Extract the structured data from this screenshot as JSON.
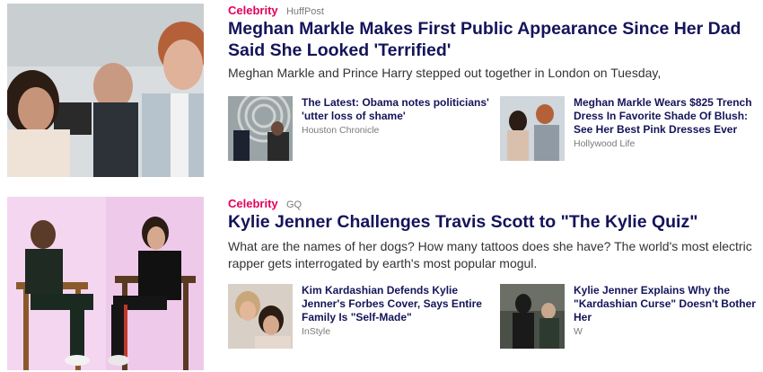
{
  "stories": [
    {
      "category": "Celebrity",
      "source": "HuffPost",
      "headline": "Meghan Markle Makes First Public Appearance Since Her Dad Said She Looked 'Terrified'",
      "summary": "Meghan Markle and Prince Harry stepped out together in London on Tuesday,",
      "related": [
        {
          "title": "The Latest: Obama notes politicians' 'utter loss of shame'",
          "source": "Houston Chronicle"
        },
        {
          "title": "Meghan Markle Wears $825 Trench Dress In Favorite Shade Of Blush: See Her Best Pink Dresses Ever",
          "source": "Hollywood Life"
        }
      ]
    },
    {
      "category": "Celebrity",
      "source": "GQ",
      "headline": "Kylie Jenner Challenges Travis Scott to \"The Kylie Quiz\"",
      "summary": "What are the names of her dogs? How many tattoos does she have? The world's most electric rapper gets interrogated by earth's most popular mogul.",
      "related": [
        {
          "title": "Kim Kardashian Defends Kylie Jenner's Forbes Cover, Says Entire Family Is \"Self-Made\"",
          "source": "InStyle"
        },
        {
          "title": "Kylie Jenner Explains Why the \"Kardashian Curse\" Doesn't Bother Her",
          "source": "W"
        }
      ]
    }
  ],
  "colors": {
    "category": "#e5005b",
    "headline": "#14145a",
    "source": "#7a7a7a",
    "summary": "#333333"
  }
}
